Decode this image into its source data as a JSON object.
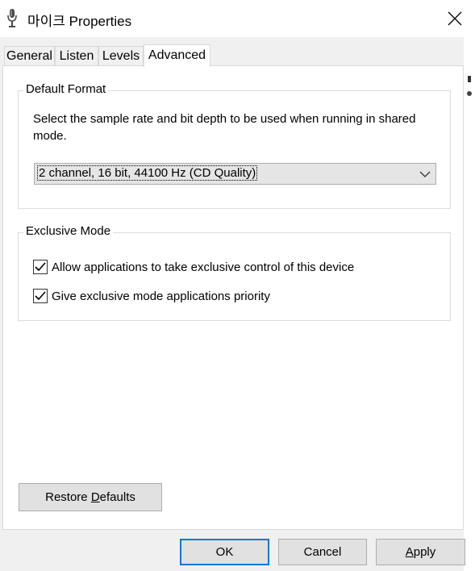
{
  "window": {
    "title": "마이크 Properties",
    "title_icon": "microphone-icon",
    "close_icon": "close-icon"
  },
  "tabs": [
    {
      "label": "General",
      "active": false
    },
    {
      "label": "Listen",
      "active": false
    },
    {
      "label": "Levels",
      "active": false
    },
    {
      "label": "Advanced",
      "active": true
    }
  ],
  "default_format": {
    "legend": "Default Format",
    "description": "Select the sample rate and bit depth to be used when running in shared mode.",
    "selected": "2 channel, 16 bit, 44100 Hz (CD Quality)"
  },
  "exclusive_mode": {
    "legend": "Exclusive Mode",
    "options": [
      {
        "label": "Allow applications to take exclusive control of this device",
        "checked": true
      },
      {
        "label": "Give exclusive mode applications priority",
        "checked": true
      }
    ]
  },
  "buttons": {
    "restore_pre": "Restore ",
    "restore_accel": "D",
    "restore_post": "efaults",
    "ok": "OK",
    "cancel": "Cancel",
    "apply_accel": "A",
    "apply_post": "pply"
  },
  "colors": {
    "focus_border": "#0078d7",
    "dialog_bg": "#f0f0f0",
    "panel_bg": "#ffffff"
  }
}
